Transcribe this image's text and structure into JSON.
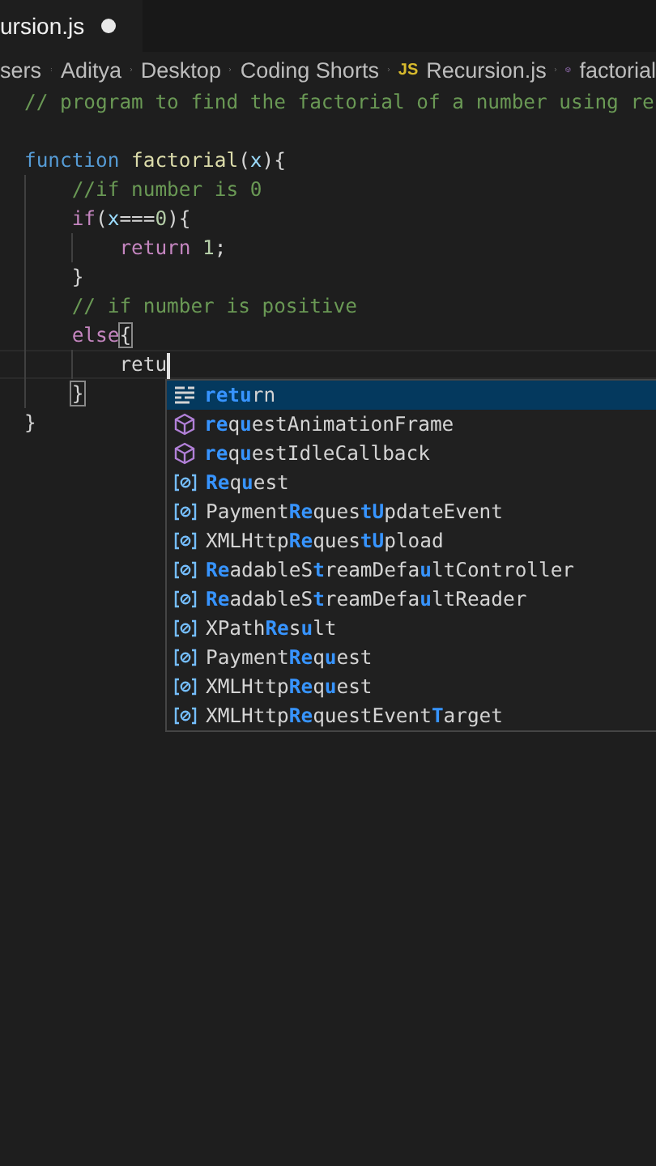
{
  "tab": {
    "label": "ursion.js",
    "modified": true,
    "selected": true
  },
  "breadcrumbs": [
    {
      "label": "sers",
      "kind": "folder"
    },
    {
      "label": "Aditya",
      "kind": "folder"
    },
    {
      "label": "Desktop",
      "kind": "folder"
    },
    {
      "label": "Coding Shorts",
      "kind": "folder"
    },
    {
      "label": "Recursion.js",
      "kind": "file",
      "badge": "JS"
    },
    {
      "label": "factorial",
      "kind": "symbol"
    }
  ],
  "code_lines": [
    {
      "kind": "code",
      "tokens": [
        {
          "text": "// program to find the factorial of a number using re",
          "kind": "comment"
        }
      ]
    },
    {
      "kind": "blank"
    },
    {
      "kind": "code",
      "tokens": [
        {
          "text": "function",
          "kind": "keyword"
        },
        {
          "text": "factorial",
          "kind": "function",
          "space_before": true
        },
        {
          "text": "(",
          "kind": "plain"
        },
        {
          "text": "x",
          "kind": "param"
        },
        {
          "text": "){",
          "kind": "plain"
        }
      ],
      "children": [
        {
          "kind": "code",
          "tokens": [
            {
              "text": "//if number is 0",
              "kind": "comment"
            }
          ]
        },
        {
          "kind": "code",
          "tokens": [
            {
              "text": "if",
              "kind": "control"
            },
            {
              "text": "(",
              "kind": "plain"
            },
            {
              "text": "x",
              "kind": "param"
            },
            {
              "text": "===",
              "kind": "plain"
            },
            {
              "text": "0",
              "kind": "number"
            },
            {
              "text": "){",
              "kind": "plain"
            }
          ],
          "children": [
            {
              "kind": "code",
              "tokens": [
                {
                  "text": "return",
                  "kind": "control"
                },
                {
                  "text": "1",
                  "kind": "number",
                  "space_before": true
                },
                {
                  "text": ";",
                  "kind": "plain"
                }
              ]
            }
          ]
        },
        {
          "kind": "code",
          "tokens": [
            {
              "text": "}",
              "kind": "plain"
            }
          ]
        },
        {
          "kind": "code",
          "tokens": [
            {
              "text": "// if number is positive",
              "kind": "comment"
            }
          ]
        },
        {
          "kind": "code",
          "tokens": [
            {
              "text": "else",
              "kind": "control"
            },
            {
              "text": "{",
              "kind": "bracket-match"
            }
          ],
          "children": [
            {
              "kind": "code",
              "current": true,
              "tokens": [
                {
                  "text": "retu",
                  "kind": "plain"
                }
              ]
            }
          ]
        },
        {
          "kind": "code",
          "tokens": [
            {
              "text": "}",
              "kind": "bracket-match"
            }
          ]
        }
      ]
    },
    {
      "kind": "code",
      "tokens": [
        {
          "text": "}",
          "kind": "plain"
        }
      ]
    }
  ],
  "suggestions": [
    {
      "kind": "keyword",
      "selected": true,
      "parts": [
        {
          "text": "retu",
          "match": true
        },
        {
          "text": "rn",
          "match": false
        }
      ]
    },
    {
      "kind": "method",
      "selected": false,
      "parts": [
        {
          "text": "re",
          "match": true
        },
        {
          "text": "q",
          "match": false
        },
        {
          "text": "u",
          "match": true
        },
        {
          "text": "est",
          "match": false
        },
        {
          "text": "AnimationFrame",
          "match": false
        }
      ]
    },
    {
      "kind": "method",
      "selected": false,
      "parts": [
        {
          "text": "re",
          "match": true
        },
        {
          "text": "q",
          "match": false
        },
        {
          "text": "u",
          "match": true
        },
        {
          "text": "est",
          "match": false
        },
        {
          "text": "IdleCallback",
          "match": false
        }
      ]
    },
    {
      "kind": "variable",
      "selected": false,
      "parts": [
        {
          "text": "Re",
          "match": true
        },
        {
          "text": "q",
          "match": false
        },
        {
          "text": "u",
          "match": true
        },
        {
          "text": "est",
          "match": false
        }
      ]
    },
    {
      "kind": "variable",
      "selected": false,
      "parts": [
        {
          "text": "Payment",
          "match": false
        },
        {
          "text": "Re",
          "match": true
        },
        {
          "text": "ques",
          "match": false
        },
        {
          "text": "tU",
          "match": true
        },
        {
          "text": "pdateEvent",
          "match": false
        }
      ]
    },
    {
      "kind": "variable",
      "selected": false,
      "parts": [
        {
          "text": "XMLHttp",
          "match": false
        },
        {
          "text": "Re",
          "match": true
        },
        {
          "text": "ques",
          "match": false
        },
        {
          "text": "tU",
          "match": true
        },
        {
          "text": "pload",
          "match": false
        }
      ]
    },
    {
      "kind": "variable",
      "selected": false,
      "parts": [
        {
          "text": "Re",
          "match": true
        },
        {
          "text": "adableS",
          "match": false
        },
        {
          "text": "t",
          "match": true
        },
        {
          "text": "reamDefa",
          "match": false
        },
        {
          "text": "u",
          "match": true
        },
        {
          "text": "ltController",
          "match": false
        }
      ]
    },
    {
      "kind": "variable",
      "selected": false,
      "parts": [
        {
          "text": "Re",
          "match": true
        },
        {
          "text": "adableS",
          "match": false
        },
        {
          "text": "t",
          "match": true
        },
        {
          "text": "reamDefa",
          "match": false
        },
        {
          "text": "u",
          "match": true
        },
        {
          "text": "ltReader",
          "match": false
        }
      ]
    },
    {
      "kind": "variable",
      "selected": false,
      "parts": [
        {
          "text": "XPath",
          "match": false
        },
        {
          "text": "Re",
          "match": true
        },
        {
          "text": "s",
          "match": false
        },
        {
          "text": "u",
          "match": true
        },
        {
          "text": "lt",
          "match": false
        }
      ]
    },
    {
      "kind": "variable",
      "selected": false,
      "parts": [
        {
          "text": "Payment",
          "match": false
        },
        {
          "text": "Re",
          "match": true
        },
        {
          "text": "q",
          "match": false
        },
        {
          "text": "u",
          "match": true
        },
        {
          "text": "est",
          "match": false
        }
      ]
    },
    {
      "kind": "variable",
      "selected": false,
      "parts": [
        {
          "text": "XMLHttp",
          "match": false
        },
        {
          "text": "Re",
          "match": true
        },
        {
          "text": "q",
          "match": false
        },
        {
          "text": "u",
          "match": true
        },
        {
          "text": "est",
          "match": false
        }
      ]
    },
    {
      "kind": "variable",
      "selected": false,
      "parts": [
        {
          "text": "XMLHttp",
          "match": false
        },
        {
          "text": "Re",
          "match": true
        },
        {
          "text": "questEvent",
          "match": false
        },
        {
          "text": "T",
          "match": true
        },
        {
          "text": "arget",
          "match": false
        }
      ]
    }
  ]
}
